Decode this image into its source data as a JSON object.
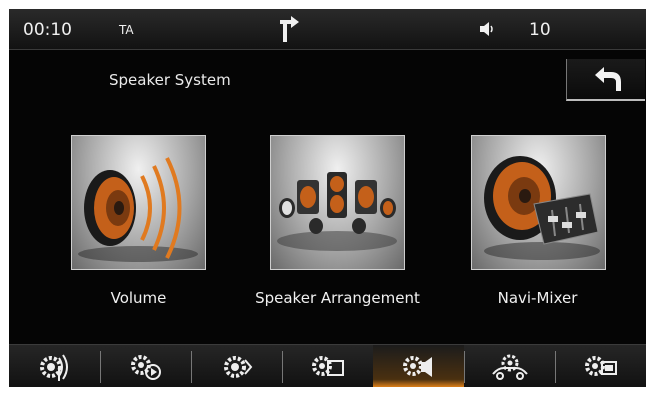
{
  "status": {
    "time": "00:10",
    "ta": "TA",
    "volume": "10",
    "icons": [
      "navigation-turn-icon",
      "speaker-volume-icon"
    ]
  },
  "header": {
    "title": "Speaker System",
    "back_icon": "back-arrow-icon"
  },
  "tiles": [
    {
      "label": "Volume",
      "icon": "speaker-volume-waves-icon"
    },
    {
      "label": "Speaker Arrangement",
      "icon": "speaker-arrangement-icon"
    },
    {
      "label": "Navi-Mixer",
      "icon": "speaker-mixer-icon"
    }
  ],
  "bottom_bar": {
    "active_index": 4,
    "items": [
      "antenna-settings-icon",
      "media-settings-icon",
      "general-settings-icon",
      "display-settings-icon",
      "speaker-settings-icon",
      "vehicle-settings-icon",
      "screen-settings-icon"
    ]
  },
  "colors": {
    "accent": "#f08a1a",
    "background": "#050505",
    "text": "#f0f0f0"
  }
}
